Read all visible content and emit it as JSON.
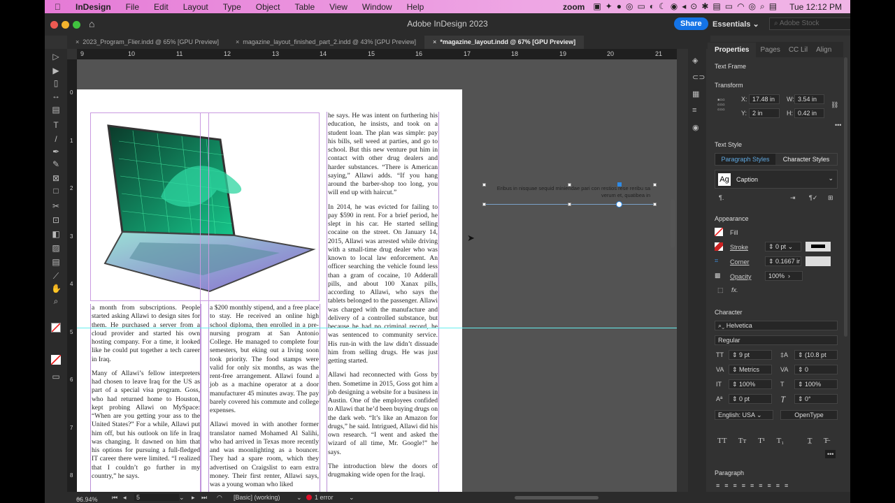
{
  "menubar": {
    "app": "InDesign",
    "items": [
      "File",
      "Edit",
      "Layout",
      "Type",
      "Object",
      "Table",
      "View",
      "Window",
      "Help"
    ],
    "zoom": "zoom",
    "clock": "Tue 12:12 PM"
  },
  "window": {
    "title": "Adobe InDesign 2023",
    "share": "Share",
    "workspace": "Essentials",
    "stock_placeholder": "Adobe Stock"
  },
  "tabs": [
    "2023_Program_Flier.indd @ 65% [GPU Preview]",
    "magazine_layout_finished_part_2.indd @ 43% [GPU Preview]",
    "*magazine_layout.indd @ 67% [GPU Preview]"
  ],
  "ruler": {
    "h": [
      "9",
      "10",
      "11",
      "12",
      "13",
      "14",
      "15",
      "16",
      "17",
      "18",
      "19",
      "20",
      "21"
    ],
    "v": [
      "0",
      "1",
      "2",
      "3",
      "4",
      "5",
      "6",
      "7",
      "8"
    ]
  },
  "caption_text": "Eribus in nisquae sequid miniendae pari con restios rese reribu sa verum et, quatibea in",
  "columns": {
    "col1": [
      "a month from subscriptions. People started asking Allawi to design sites for them. He purchased a server from a cloud provider and started his own hosting company. For a time, it looked like he could put together a tech career in Iraq.",
      "Many of Allawi’s fellow interpreters had chosen to leave Iraq for the US as part of a special visa program. Goss, who had returned home to Houston, kept probing Allawi on MySpace: “When are you getting your ass to the United States?” For a while, Allawi put him off, but his outlook on life in Iraq was changing. It dawned on him that his options for pursuing a full-fledged IT career there were limited. “I realized that I couldn’t go further in my country,” he says."
    ],
    "col2": [
      "a $200 monthly stipend, and a free place to stay. He received an online high school diploma, then enrolled in a pre-nursing program at San Antonio College. He managed to complete four semesters, but eking out a living soon took priority. The food stamps were valid for only six months, as was the rent-free arrangement. Allawi found a job as a machine operator at a door manufacturer 45 minutes away. The pay barely covered his commute and college expenses.",
      "Allawi moved in with another former translator named Mohamed Al Salihi, who had arrived in Texas more recently and was moonlighting as a bouncer. They had a spare room, which they advertised on Craigslist to earn extra money. Their first renter, Allawi says, was a young woman who liked"
    ],
    "col3": [
      "he says. He was intent on furthering his education, he insists, and took on a student loan. The plan was simple: pay his bills, sell weed at parties, and go to school. But this new venture put him in contact with other drug dealers and harder substances. “There is American saying,” Allawi adds. “If you hang around the barber-shop too long, you will end up with haircut.”",
      "In 2014, he was evicted for failing to pay $590 in rent. For a brief period, he slept in his car. He started selling cocaine on the street. On January 14, 2015, Allawi was arrested while driving with a small-time drug dealer who was known to local law enforcement. An officer searching the vehicle found less than a gram of cocaine, 10 Adderall pills, and about 100 Xanax pills, according to Allawi, who says the tablets belonged to the passenger. Allawi was charged with the manufacture and delivery of a controlled substance, but because he had no criminal record, he was sentenced to community service. His run-in with the law didn’t dissuade him from selling drugs. He was just getting started.",
      "Allawi had reconnected with Goss by then. Sometime in 2015, Goss got him a job designing a website for a business in Austin. One of the employees confided to Allawi that he’d been buying drugs on the dark web. “It’s like an Amazon for drugs,” he said. Intrigued, Allawi did his own research. “I went and asked the wizard of all time, Mr. Google!” he says.",
      "The introduction blew the doors of drugmaking wide open for the Iraqi."
    ]
  },
  "panel": {
    "tabs": [
      "Properties",
      "Pages",
      "CC Lil",
      "Align"
    ],
    "frame_type": "Text Frame",
    "transform": "Transform",
    "x_label": "X:",
    "x": "17.48 in",
    "y_label": "Y:",
    "y": "2 in",
    "w_label": "W:",
    "w": "3.54 in",
    "h_label": "H:",
    "h": "0.42 in",
    "text_style": "Text Style",
    "para_styles": "Paragraph Styles",
    "char_styles": "Character Styles",
    "style": "Caption",
    "style_icon": "Ag",
    "appearance": "Appearance",
    "fill": "Fill",
    "stroke": "Stroke",
    "stroke_val": "0 pt",
    "corner": "Corner",
    "corner_val": "0.1667 ir",
    "opacity": "Opacity",
    "opacity_val": "100%",
    "character": "Character",
    "font": "Helvetica",
    "font_style": "Regular",
    "size": "9 pt",
    "leading": "(10.8 pt",
    "kerning": "Metrics",
    "tracking": "0",
    "vscale": "100%",
    "hscale": "100%",
    "baseline": "0 pt",
    "skew": "0°",
    "language": "English: USA",
    "opentype": "OpenType",
    "paragraph": "Paragraph"
  },
  "status": {
    "zoom": "66.94%",
    "page": "5",
    "preflight_profile": "[Basic] (working)",
    "errors": "1 error"
  }
}
